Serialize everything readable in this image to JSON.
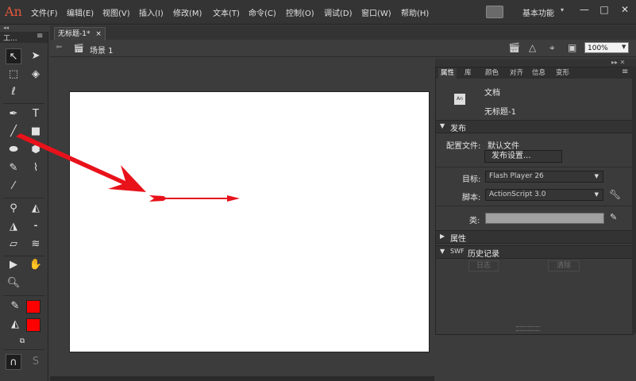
{
  "app": {
    "logo": "An",
    "menu": [
      "文件(F)",
      "编辑(E)",
      "视图(V)",
      "插入(I)",
      "修改(M)",
      "文本(T)",
      "命令(C)",
      "控制(O)",
      "调试(D)",
      "窗口(W)",
      "帮助(H)"
    ],
    "workspace": "基本功能",
    "window_controls": {
      "minimize": "—",
      "restore": "□",
      "close": "✕"
    }
  },
  "toolbar_panel": {
    "title": "工..."
  },
  "document": {
    "tab_title": "无标题-1*",
    "tab_close": "×",
    "scene": "场景 1",
    "zoom": "100%"
  },
  "properties": {
    "tabs": [
      "属性",
      "库",
      "颜色",
      "对齐",
      "信息",
      "变形"
    ],
    "doc_icon_text": "An",
    "doc_type": "文档",
    "doc_name": "无标题-1",
    "publish": {
      "section_title": "发布",
      "profile_label": "配置文件:",
      "profile_value": "默认文件",
      "settings_button": "发布设置...",
      "target_label": "目标:",
      "target_value": "Flash Player 26",
      "script_label": "脚本:",
      "script_value": "ActionScript 3.0",
      "class_label": "类:"
    },
    "props_section": "属性",
    "swf_section": {
      "prefix": "SWF",
      "title": "历史记录"
    },
    "log_button": "日志",
    "clear_button": "清除"
  },
  "colors": {
    "stroke_color": "#ff0000",
    "fill_color": "#ff0000",
    "arrow_color": "#e8121b"
  }
}
